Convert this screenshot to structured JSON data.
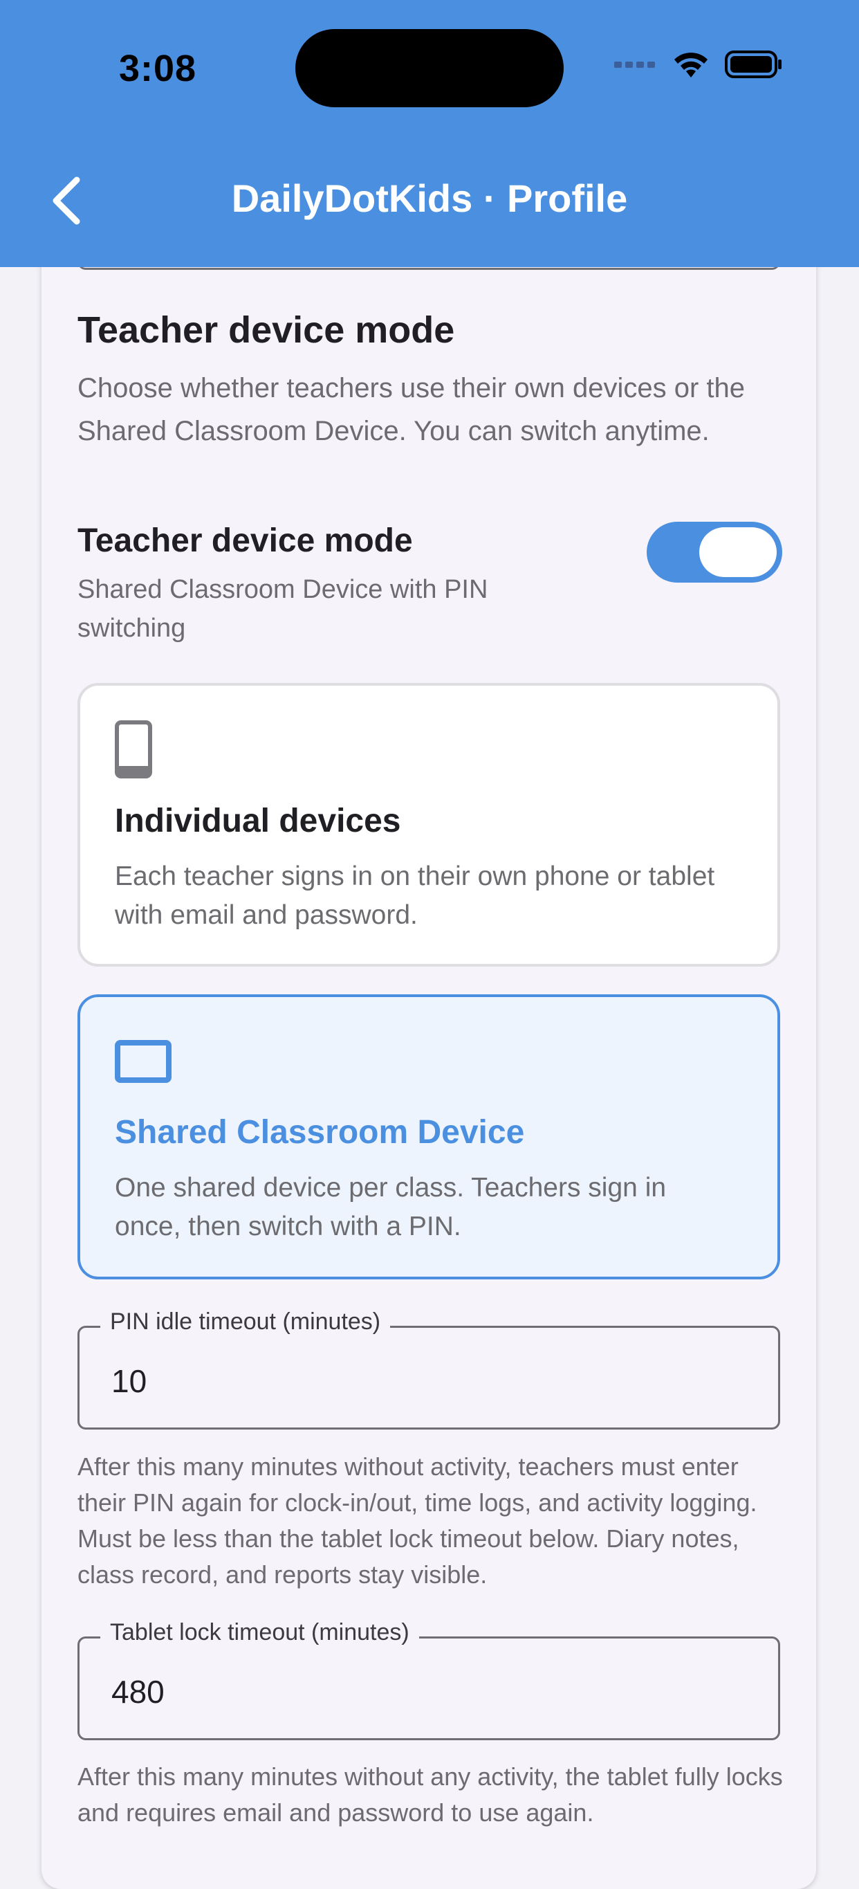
{
  "status_bar": {
    "time": "3:08"
  },
  "app_bar": {
    "title": "DailyDotKids · Profile",
    "back_icon": "chevron-left-icon"
  },
  "teacher_device_section": {
    "title": "Teacher device mode",
    "description": "Choose whether teachers use their own devices or the Shared Classroom Device. You can switch anytime.",
    "toggle": {
      "label": "Teacher device mode",
      "subtitle": "Shared Classroom Device with PIN switching",
      "on": true
    },
    "options": [
      {
        "icon": "phone-icon",
        "title": "Individual devices",
        "description": "Each teacher signs in on their own phone or tablet with email and password.",
        "selected": false
      },
      {
        "icon": "tablet-icon",
        "title": "Shared Classroom Device",
        "description": "One shared device per class. Teachers sign in once, then switch with a PIN.",
        "selected": true
      }
    ]
  },
  "pin_timeout": {
    "label": "PIN idle timeout (minutes)",
    "value": "10",
    "help": "After this many minutes without activity, teachers must enter their PIN again for clock-in/out, time logs, and activity logging. Must be less than the tablet lock timeout below. Diary notes, class record, and reports stay visible."
  },
  "tablet_lock_timeout": {
    "label": "Tablet lock timeout (minutes)",
    "value": "480",
    "help": "After this many minutes without any activity, the tablet fully locks and requires email and password to use again."
  },
  "colors": {
    "primary": "#4a8fe0",
    "background": "#f3f2f7",
    "card": "#f7f3fa",
    "selected_card": "#eef4fd",
    "text_secondary": "#6b6b70"
  }
}
